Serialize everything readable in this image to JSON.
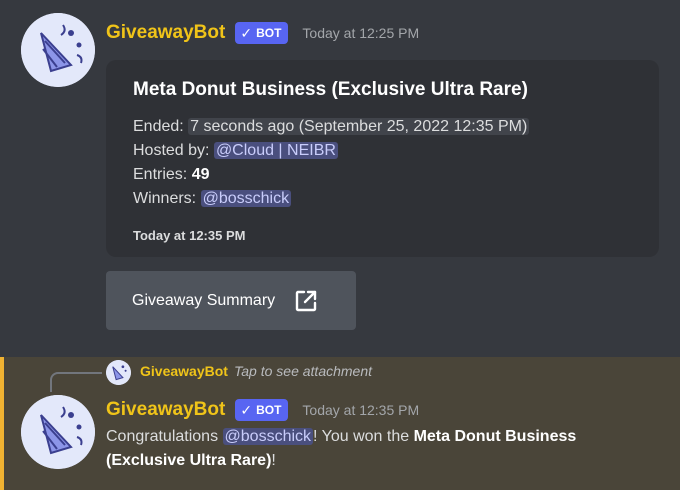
{
  "colors": {
    "background": "#36393f",
    "username": "#f0c419",
    "bot_tag": "#5865f2",
    "embed_bg": "#2f3136",
    "button_bg": "#4f545c",
    "highlight_bg": "#4a4539",
    "highlight_bar": "#f0b232",
    "mention_bg": "#4a4f7e"
  },
  "message1": {
    "username": "GiveawayBot",
    "bot_tag": "BOT",
    "bot_tag_icon": "checkmark-icon",
    "timestamp": "Today at 12:25 PM",
    "avatar_icon": "party-popper-icon",
    "embed": {
      "title": "Meta Donut Business (Exclusive Ultra Rare)",
      "ended_label": "Ended:",
      "ended_relative": "7 seconds ago",
      "ended_absolute": "(September 25, 2022 12:35 PM)",
      "hosted_label": "Hosted by:",
      "hosted_mention": "@Cloud | NEIBR",
      "entries_label": "Entries:",
      "entries_value": "49",
      "winners_label": "Winners:",
      "winners_mention": "@bosschick",
      "footer": "Today at 12:35 PM"
    },
    "button": {
      "label": "Giveaway Summary",
      "icon": "external-link-icon"
    }
  },
  "message2": {
    "reply": {
      "username": "GiveawayBot",
      "text": "Tap to see attachment"
    },
    "username": "GiveawayBot",
    "bot_tag": "BOT",
    "timestamp": "Today at 12:35 PM",
    "content": {
      "prefix": "Congratulations",
      "mention": "@bosschick",
      "middle": "! You won the",
      "prize_line1": "Meta Donut Business",
      "prize_line2": "(Exclusive Ultra Rare)",
      "suffix": "!"
    }
  }
}
